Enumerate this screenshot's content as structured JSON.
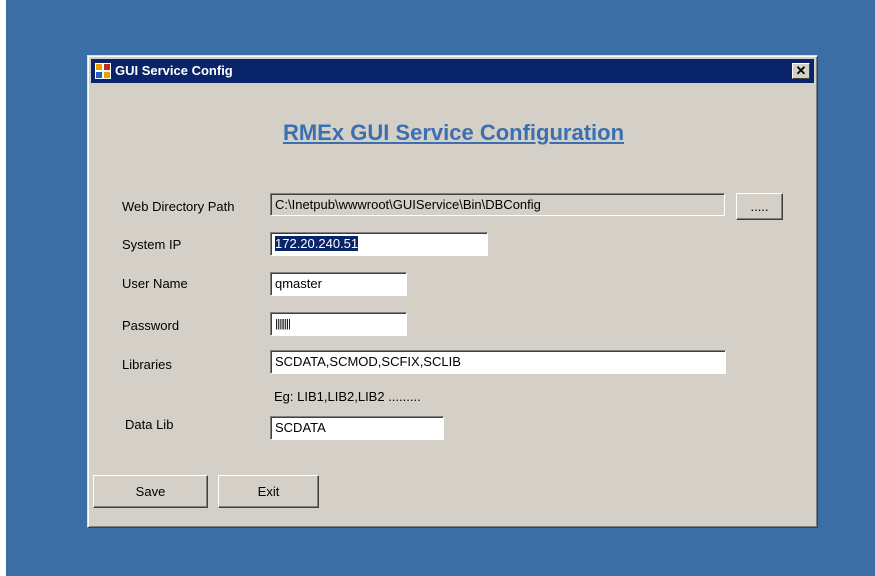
{
  "window": {
    "title": "GUI Service Config",
    "close_glyph": "✕"
  },
  "form": {
    "heading": "RMEx GUI Service Configuration",
    "web_directory": {
      "label": "Web Directory Path",
      "value": "C:\\Inetpub\\wwwroot\\GUIService\\Bin\\DBConfig",
      "browse_label": "....."
    },
    "system_ip": {
      "label": "System IP",
      "value": "172.20.240.51"
    },
    "user_name": {
      "label": "User Name",
      "value": "qmaster"
    },
    "password": {
      "label": "Password",
      "value": "||||||||"
    },
    "libraries": {
      "label": "Libraries",
      "value": "SCDATA,SCMOD,SCFIX,SCLIB",
      "hint": "Eg: LIB1,LIB2,LIB2 ........."
    },
    "data_lib": {
      "label": "Data Lib",
      "value": "SCDATA"
    }
  },
  "buttons": {
    "save": "Save",
    "exit": "Exit"
  },
  "colors": {
    "desktop": "#3a6ea5",
    "titlebar": "#0a246a",
    "window_face": "#d4d0c8",
    "heading": "#3b6fb0"
  }
}
